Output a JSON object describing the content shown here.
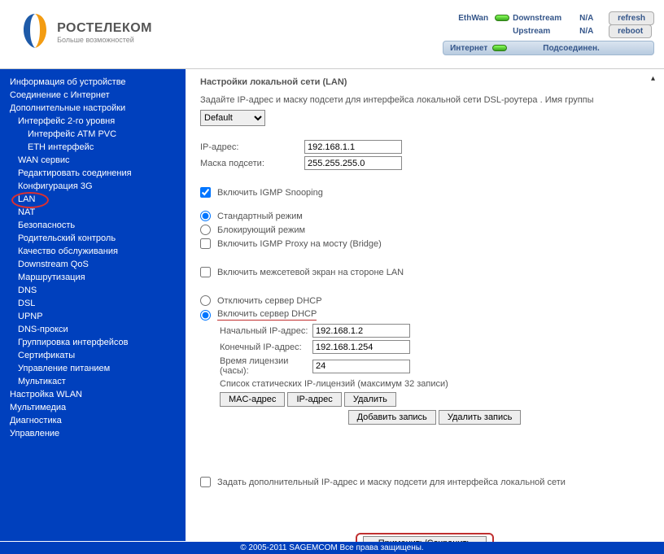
{
  "brand": {
    "name": "РОСТЕЛЕКОМ",
    "tagline": "Больше возможностей"
  },
  "status": {
    "ethwan_label": "EthWan",
    "downstream_label": "Downstream",
    "upstream_label": "Upstream",
    "down_val": "N/A",
    "up_val": "N/A",
    "refresh": "refresh",
    "reboot": "reboot",
    "internet_label": "Интернет",
    "internet_status": "Подсоединен."
  },
  "nav": {
    "device_info": "Информация об устройстве",
    "internet_conn": "Соединение с Интернет",
    "advanced": "Дополнительные настройки",
    "l2_interface": "Интерфейс 2-го уровня",
    "atm_pvc": "Интерфейс ATM PVC",
    "eth_iface": "ETH интерфейс",
    "wan_service": "WAN сервис",
    "edit_conn": "Редактировать соединения",
    "cfg_3g": "Конфигурация 3G",
    "lan": "LAN",
    "nat": "NAT",
    "security": "Безопасность",
    "parental": "Родительский контроль",
    "qos": "Качество обслуживания",
    "downstream_qos": "Downstream QoS",
    "routing": "Маршрутизация",
    "dns": "DNS",
    "dsl": "DSL",
    "upnp": "UPNP",
    "dns_proxy": "DNS-прокси",
    "iface_group": "Группировка интерфейсов",
    "certs": "Сертификаты",
    "power_mgmt": "Управление питанием",
    "multicast": "Мультикаст",
    "wlan": "Настройка WLAN",
    "multimedia": "Мультимедиа",
    "diag": "Диагностика",
    "mgmt": "Управление"
  },
  "page": {
    "title": "Настройки локальной сети (LAN)",
    "desc": "Задайте IP-адрес и маску подсети для интерфейса локальной сети DSL-роутера .  Имя группы",
    "group_select": "Default",
    "ip_label": "IP-адрес:",
    "ip_value": "192.168.1.1",
    "mask_label": "Маска подсети:",
    "mask_value": "255.255.255.0",
    "igmp_snooping": "Включить IGMP Snooping",
    "std_mode": "Стандартный режим",
    "block_mode": "Блокирующий режим",
    "igmp_proxy": "Включить IGMP Proxy на мосту (Bridge)",
    "lan_firewall": "Включить межсетевой экран на стороне LAN",
    "dhcp_off": "Отключить сервер DHCP",
    "dhcp_on": "Включить сервер DHCP",
    "dhcp_start_label": "Начальный IP-адрес:",
    "dhcp_start_val": "192.168.1.2",
    "dhcp_end_label": "Конечный IP-адрес:",
    "dhcp_end_val": "192.168.1.254",
    "lease_label": "Время лицензии (часы):",
    "lease_val": "24",
    "static_list": "Список статических IP-лицензий (максимум 32 записи)",
    "mac_col": "MAC-адрес",
    "ip_col": "IP-адрес",
    "del_col": "Удалить",
    "add_entry": "Добавить запись",
    "del_entry": "Удалить запись",
    "second_ip": "Задать дополнительный IP-адрес и маску подсети для интерфейса локальной сети",
    "apply": "Применить/Сохранить"
  },
  "footer": {
    "copyright": "© 2005-2011 SAGEMCOM  Все права защищены."
  }
}
